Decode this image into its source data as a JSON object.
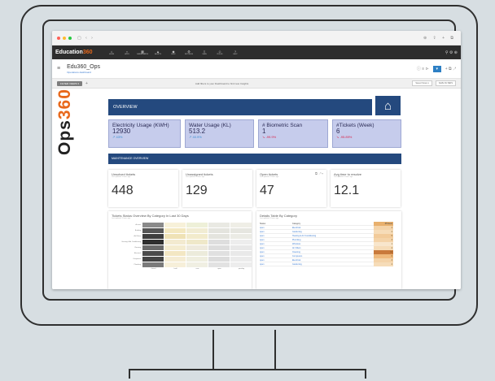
{
  "browser": {
    "dots": [
      "#ff5f57",
      "#febc2e",
      "#28c840"
    ],
    "icons": "▢ ‹ ›",
    "right_icons": "⊕ ⇪ + ⧉"
  },
  "app": {
    "brand": "Education",
    "brand_accent": "360",
    "nav": [
      {
        "icon": "home-icon",
        "glyph": "⌂",
        "label": "HOME"
      },
      {
        "icon": "apps-icon",
        "glyph": "▪",
        "label": "APPS"
      },
      {
        "icon": "dashboards-icon",
        "glyph": "▦",
        "label": "DASHBOARDS"
      },
      {
        "icon": "alerts-icon",
        "glyph": "▲",
        "label": "ALERTS"
      },
      {
        "icon": "bulk-icon",
        "glyph": "◆",
        "label": "BULK"
      },
      {
        "icon": "settings-icon",
        "glyph": "⚙",
        "label": "SETTINGS"
      },
      {
        "icon": "data-icon",
        "glyph": "≡",
        "label": "DATA"
      },
      {
        "icon": "roles-icon",
        "glyph": "☺",
        "label": "ROLES"
      },
      {
        "icon": "help-icon",
        "glyph": "?",
        "label": "HELP"
      }
    ],
    "nav_right": "⚲ ⚙ ⊕"
  },
  "dashboard": {
    "title": "Edu360_Ops",
    "subtitle": "Operations dashboard",
    "toolbar_icons": "ⓘ ≡ ⊳",
    "toolbar_right": "+ ⧉ ↗"
  },
  "filter": {
    "button": "FILTER VIEWS ▾",
    "plus": "+",
    "message": "Add filters to your Dashboard to find new Insights",
    "saved_views": "Saved Views ▾",
    "save_filters": "SAVE FILTERS"
  },
  "logo": {
    "text": "Ops",
    "accent": "360"
  },
  "overview": {
    "title": "OVERVIEW",
    "home_glyph": "⌂"
  },
  "kpis": [
    {
      "label": "Electricity Usage (KWH)",
      "value": "12930",
      "change": "↗ 43%",
      "trend": "up"
    },
    {
      "label": "Water Usage (KL)",
      "value": "513.2",
      "change": "↗ 40.9%",
      "trend": "up"
    },
    {
      "label": "# Biometric Scan",
      "value": "1",
      "change": "↘ -99.9%",
      "trend": "down"
    },
    {
      "label": "#Tickets (Week)",
      "value": "6",
      "change": "↘ -95.89%",
      "trend": "down"
    }
  ],
  "maintenance": {
    "title": "MAINTENANCE OVERVIEW"
  },
  "tickets": [
    {
      "label": "Unsolved tickets",
      "sub": "Last updated: 3 hours ago",
      "value": "448"
    },
    {
      "label": "Unassigned tickets",
      "sub": "Last updated: 3 hours ago",
      "value": "129"
    },
    {
      "label": "Open tickets",
      "sub": "Last updated: 3 hours ago",
      "value": "47",
      "icons": "⧉ ↗ ▾"
    },
    {
      "label": "Avg time to resolve",
      "sub": "Last updated: 3 hours ago",
      "value": "12.1"
    }
  ],
  "heatmap": {
    "title": "Tickets Status Overview By Category In Last 30 Days",
    "sub": "Last updated: 3 hours ago",
    "rows": [
      "Access",
      "Building",
      "Air Filters",
      "Heating & Air Conditioning",
      "Cleaning",
      "Electrical",
      "Computers",
      "Plumbing"
    ],
    "cols": [
      "closed",
      "hold",
      "new",
      "open",
      "pending"
    ],
    "cells": [
      [
        "#8a8a8a",
        "#f7f1d9",
        "#eef0d8",
        "#e9e9e3",
        "#efeee6"
      ],
      [
        "#565656",
        "#f3e8c0",
        "#f1ecd3",
        "#e4e4de",
        "#e6e6e0"
      ],
      [
        "#3e3e3e",
        "#efe2b5",
        "#f2ebcc",
        "#e4e4de",
        "#ebebe5"
      ],
      [
        "#2f2f2f",
        "#f3ead0",
        "#efe8c9",
        "#dedede",
        "#ededed"
      ],
      [
        "#6a6a6a",
        "#f4ecd0",
        "#eeeadd",
        "#dddddd",
        "#e8e8e8"
      ],
      [
        "#4a4a4a",
        "#f3e7c3",
        "#ecebdb",
        "#e0e0e0",
        "#e9e9e9"
      ],
      [
        "#444444",
        "#f5ecd3",
        "#efeedf",
        "#dcdcdc",
        "#ebebeb"
      ],
      [
        "#7a7a7a",
        "#f6efd9",
        "#f0efe2",
        "#e2e2e2",
        "#ededed"
      ]
    ]
  },
  "details": {
    "title": "Details Table By Category",
    "sub": "Last updated: 3 hours ago",
    "headers": [
      "Status",
      "Category",
      "#Tickets"
    ],
    "rows": [
      {
        "status": "open",
        "category": "Electrical",
        "count": "4",
        "shade": "#f4d3a8"
      },
      {
        "status": "open",
        "category": "Gardening",
        "count": "2",
        "shade": "#f6dcb8"
      },
      {
        "status": "open",
        "category": "Heating & Air Conditioning",
        "count": "5",
        "shade": "#f2cb9a"
      },
      {
        "status": "open",
        "category": "Plumbing",
        "count": "3",
        "shade": "#f4d3a8"
      },
      {
        "status": "open",
        "category": "Windows",
        "count": "1",
        "shade": "#f8e6cc"
      },
      {
        "status": "open",
        "category": "Air Filters",
        "count": "2",
        "shade": "#f6dcb8"
      },
      {
        "status": "open",
        "category": "Cleaning",
        "count": "12",
        "shade": "#c97a3c"
      },
      {
        "status": "open",
        "category": "Computers",
        "count": "6",
        "shade": "#efb97c"
      },
      {
        "status": "open",
        "category": "Electrical",
        "count": "3",
        "shade": "#f4d3a8"
      },
      {
        "status": "open",
        "category": "Gardening",
        "count": "2",
        "shade": "#f6dcb8"
      }
    ]
  }
}
